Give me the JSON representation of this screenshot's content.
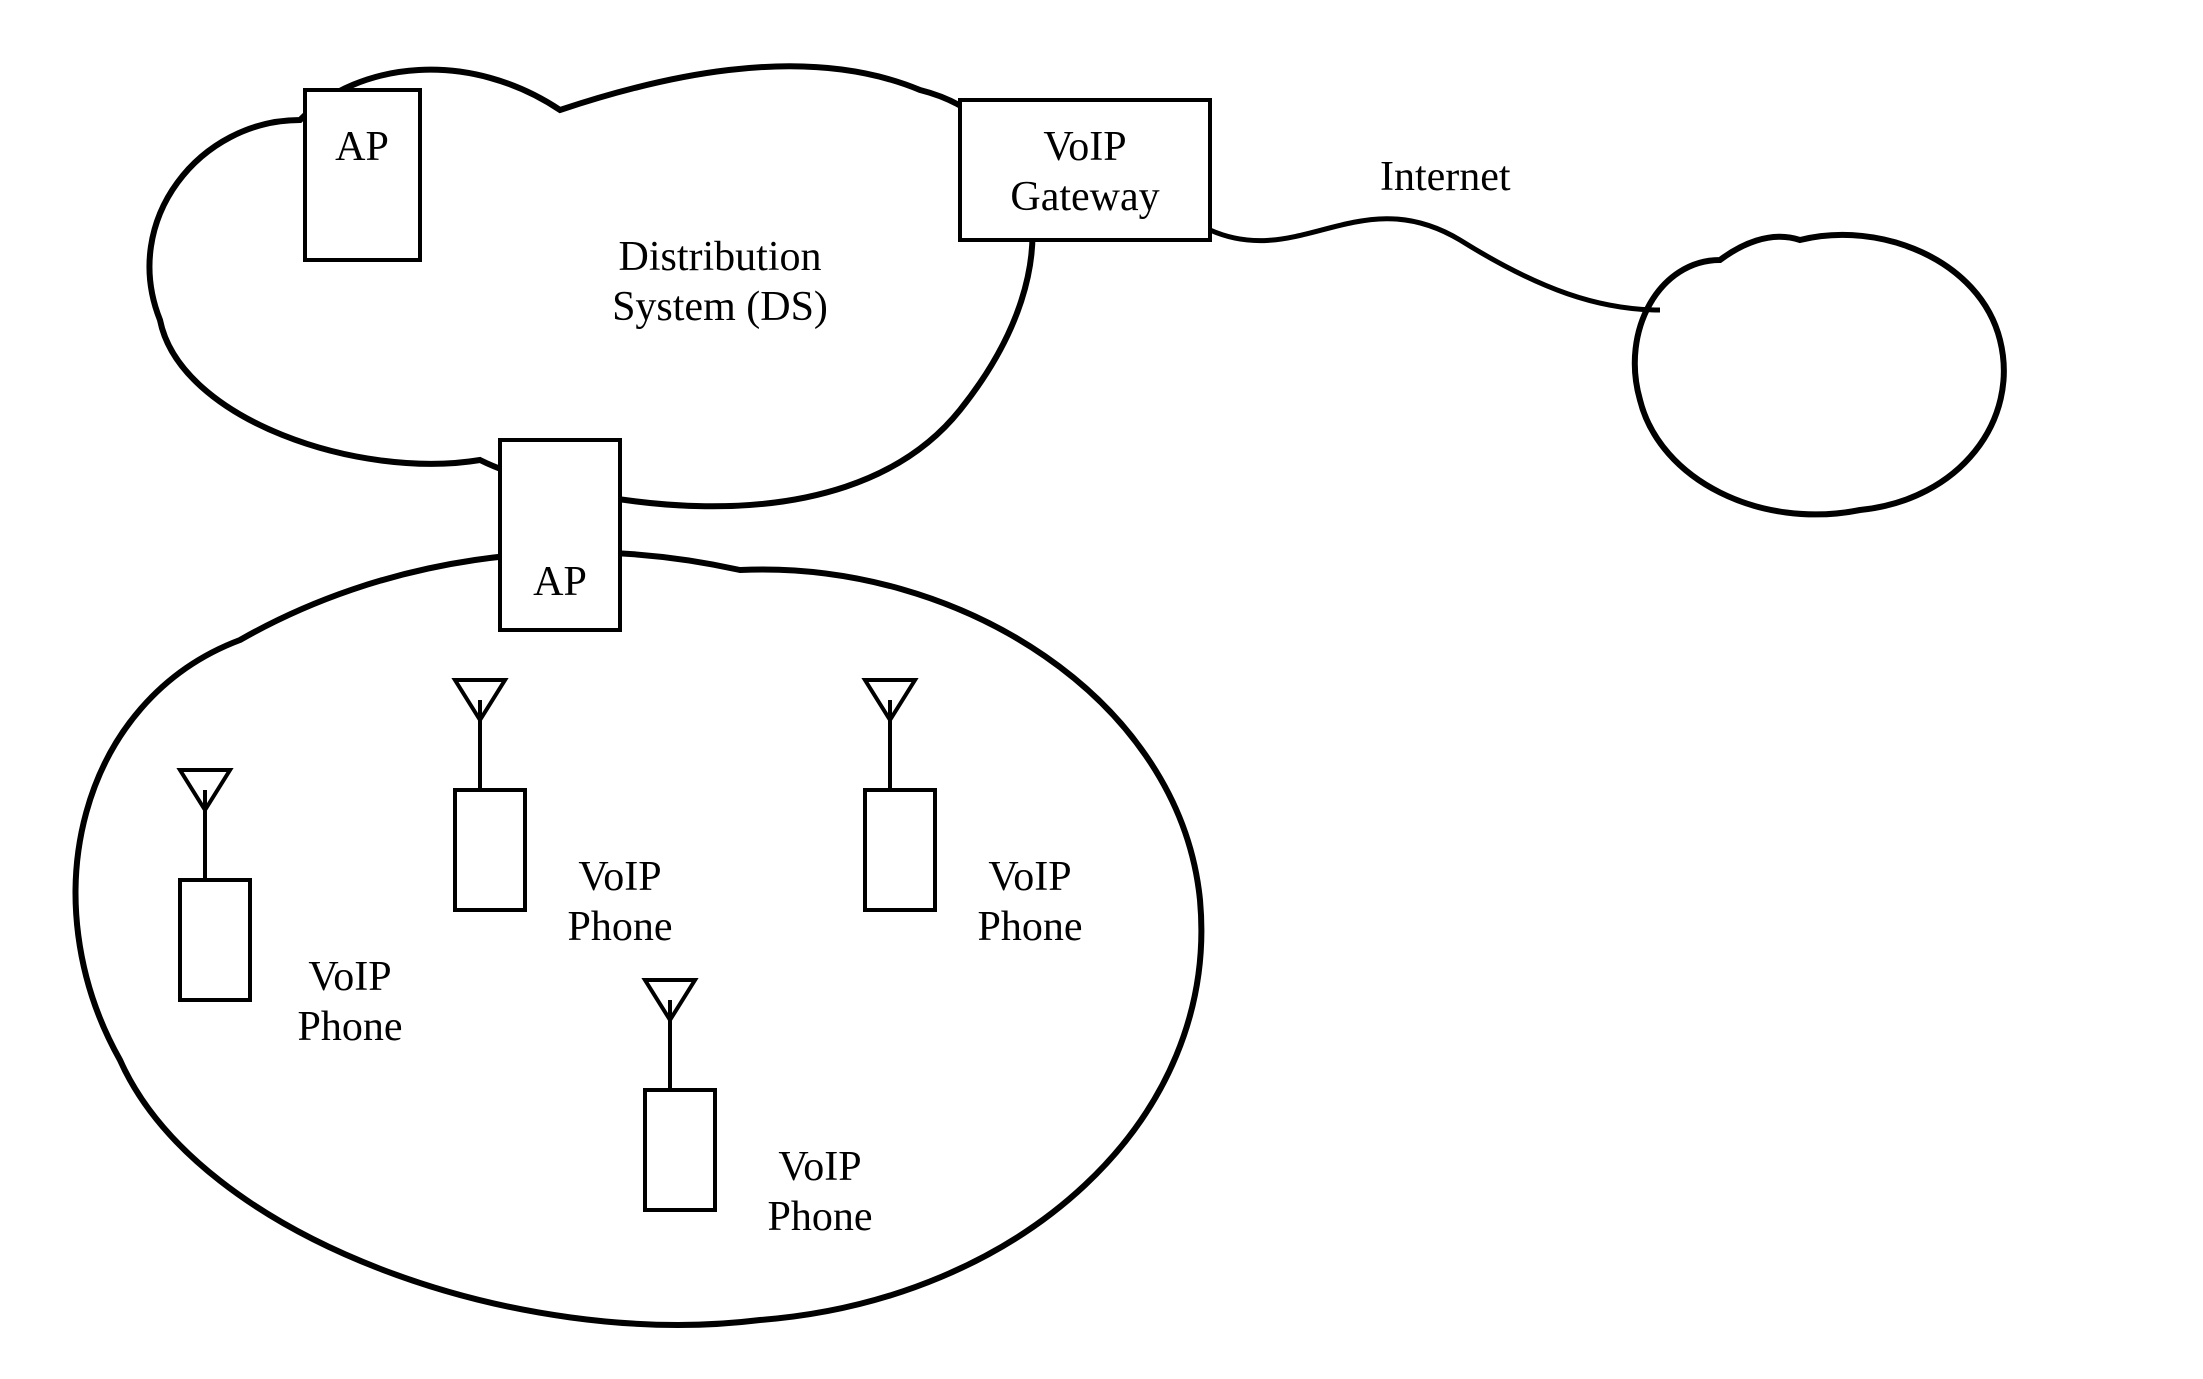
{
  "labels": {
    "ap1": "AP",
    "ap2": "AP",
    "ds_line1": "Distribution",
    "ds_line2": "System (DS)",
    "gateway_line1": "VoIP",
    "gateway_line2": "Gateway",
    "internet": "Internet",
    "phone_line1": "VoIP",
    "phone_line2": "Phone"
  },
  "diagram": {
    "type": "network-topology",
    "description": "Distribution System (DS) cloud with two Access Points (AP), one of which bridges to a wireless cell containing four VoIP phones. A VoIP Gateway on the DS connects through the Internet to a remote network.",
    "access_points": [
      {
        "id": "ap-top"
      },
      {
        "id": "ap-bottom"
      }
    ],
    "voip_phones": 4
  }
}
